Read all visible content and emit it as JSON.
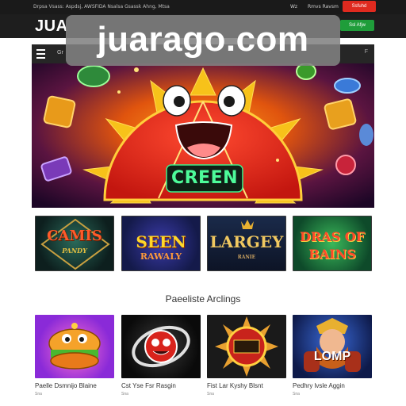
{
  "topbar": {
    "notice": "Drpsa Vsass: Aspdsj, AWSFIDA Nsalsa Gsassk Ahng, Mtsa",
    "link_short": "Wz",
    "link_mid": "Rmvs Ravsm",
    "red_button": "Ssfuhd"
  },
  "header": {
    "logo": "JUA",
    "green_button": "Ssl Afjw"
  },
  "watermark": "juarago.com",
  "nav": {
    "label": "Gr",
    "end_mark": "F"
  },
  "hero": {
    "badge_text": "CREEN"
  },
  "top_games": [
    {
      "title": "CAMIS",
      "subtitle": "PANDY"
    },
    {
      "title": "SEEN",
      "subtitle": "RAWALY"
    },
    {
      "title": "LARGEY",
      "subtitle": "RANIE"
    },
    {
      "title": "DRAS OF",
      "subtitle": "BAINS"
    }
  ],
  "section_title": "Paeeliste Arclings",
  "featured_games": [
    {
      "caption": "Paelle Dsmnijo Blaine",
      "sub": "Sna",
      "art_text": ""
    },
    {
      "caption": "Cst Yse Fsr Rasgin",
      "sub": "Sna",
      "art_text": ""
    },
    {
      "caption": "Fist Lar Kyshy Blsnt",
      "sub": "Sna",
      "art_text": ""
    },
    {
      "caption": "Pedhry lvsle Aggin",
      "sub": "Sna",
      "art_text": "LOMP"
    }
  ],
  "colors": {
    "topbar": "#1a1a1a",
    "header": "#1e1e1e",
    "red": "#e02a1f",
    "green": "#1f9d3a",
    "hero_bg": "#2a0a2e",
    "sun_orange": "#f5a000",
    "smile_red": "#e8281c"
  }
}
